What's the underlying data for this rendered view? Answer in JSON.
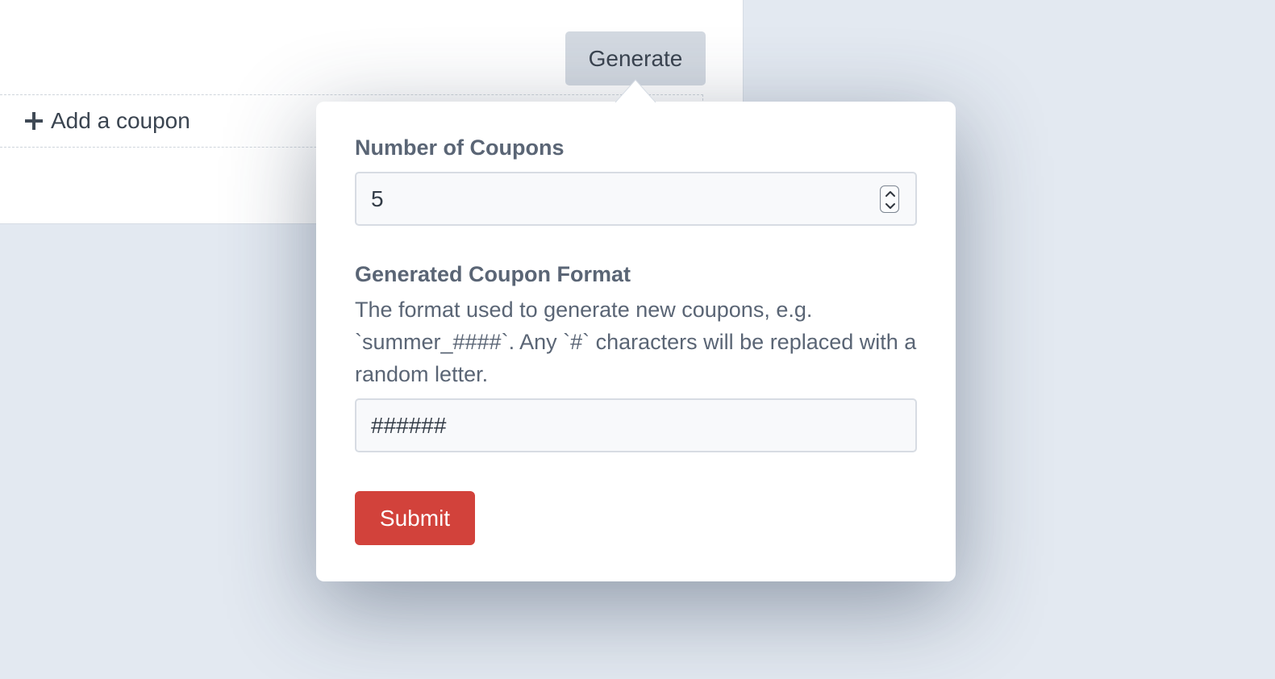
{
  "card": {
    "generate_label": "Generate",
    "add_coupon_label": "Add a coupon"
  },
  "popover": {
    "number_label": "Number of Coupons",
    "number_value": "5",
    "format_label": "Generated Coupon Format",
    "format_help": "The format used to generate new coupons, e.g. `summer_####`. Any `#` characters will be replaced with a random letter.",
    "format_value": "######",
    "submit_label": "Submit"
  },
  "colors": {
    "background": "#e3e9f1",
    "generate_button": "#d3d9e1",
    "submit_button": "#d2423b",
    "label_text": "#5a6575"
  },
  "icons": {
    "add": "plus-icon",
    "stepper_up": "chevron-up-icon",
    "stepper_down": "chevron-down-icon"
  }
}
